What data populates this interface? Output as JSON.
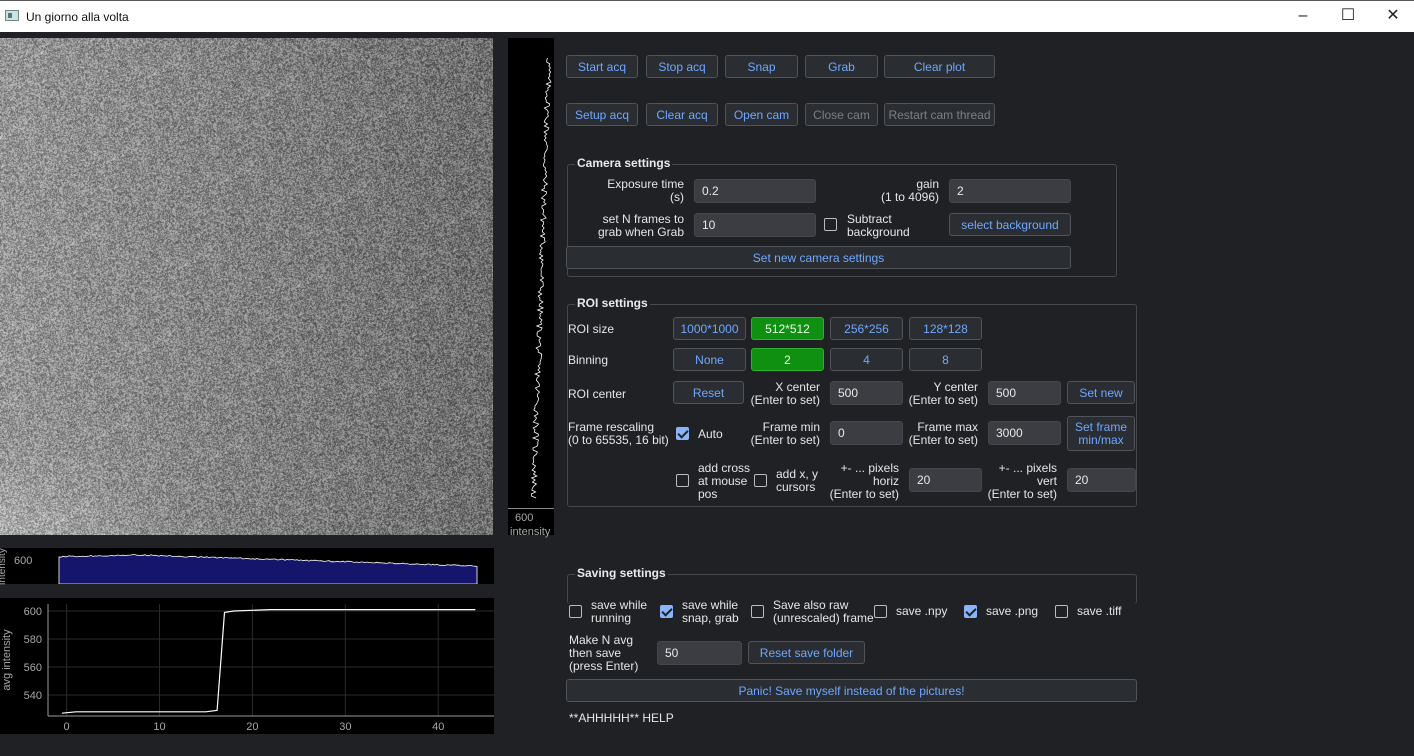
{
  "window": {
    "title": "Un giorno alla volta",
    "minimize_icon": "minimize-icon",
    "maximize_icon": "maximize-icon",
    "close_icon": "close-icon"
  },
  "toolbar": {
    "row1": [
      "Start acq",
      "Stop acq",
      "Snap",
      "Grab",
      "Clear plot"
    ],
    "row2": [
      "Setup acq",
      "Clear acq",
      "Open cam",
      "Close cam",
      "Restart cam thread"
    ]
  },
  "camera": {
    "title": "Camera settings",
    "exposure_label": "Exposure time\n(s)",
    "exposure_value": "0.2",
    "gain_label": "gain\n(1 to 4096)",
    "gain_value": "2",
    "nframes_label": "set N frames to\ngrab when Grab",
    "nframes_value": "10",
    "subtract_label": "Subtract\nbackground",
    "subtract_checked": false,
    "select_bg": "select background",
    "set_new": "Set new camera settings"
  },
  "roi": {
    "title": "ROI settings",
    "size_label": "ROI size",
    "sizes": [
      "1000*1000",
      "512*512",
      "256*256",
      "128*128"
    ],
    "size_active": 1,
    "binning_label": "Binning",
    "binnings": [
      "None",
      "2",
      "4",
      "8"
    ],
    "binning_active": 1,
    "center_label": "ROI center",
    "reset": "Reset",
    "xcenter_label": "X center\n(Enter to set)",
    "xcenter_value": "500",
    "ycenter_label": "Y center\n(Enter to set)",
    "ycenter_value": "500",
    "set_new": "Set new",
    "rescale_label": "Frame rescaling\n(0 to 65535, 16 bit)",
    "auto_label": "Auto",
    "auto_checked": true,
    "fmin_label": "Frame min\n(Enter to set)",
    "fmin_value": "0",
    "fmax_label": "Frame max\n(Enter to set)",
    "fmax_value": "3000",
    "set_frame": "Set frame\nmin/max",
    "cross_label": "add cross\nat mouse\npos",
    "cursors_label": "add x, y\ncursors",
    "horiz_label": "+- ... pixels\nhoriz\n(Enter to set)",
    "horiz_value": "20",
    "vert_label": "+- ... pixels\nvert\n(Enter to set)",
    "vert_value": "20"
  },
  "saving": {
    "title": "Saving settings",
    "options": [
      {
        "label": "save while\nrunning",
        "checked": false
      },
      {
        "label": "save while\nsnap, grab",
        "checked": true
      },
      {
        "label": "Save also raw\n(unrescaled) frame",
        "checked": false
      },
      {
        "label": "save .npy",
        "checked": false
      },
      {
        "label": "save .png",
        "checked": true
      },
      {
        "label": "save .tiff",
        "checked": false
      }
    ],
    "navg_label": "Make N avg\nthen save\n(press Enter)",
    "navg_value": "50",
    "reset_folder": "Reset save folder",
    "panic": "Panic! Save myself instead of the pictures!",
    "help": "**AHHHHH** HELP"
  },
  "side_profile": {
    "tick": "600",
    "axis_label": "intensity"
  },
  "bottom_profile": {
    "tick": "600",
    "axis_label": "intensity"
  },
  "chart_data": {
    "type": "line",
    "ylabel": "avg intensity",
    "xlabel": "",
    "xlim": [
      -2,
      46
    ],
    "ylim": [
      525,
      605
    ],
    "xticks": [
      0,
      10,
      20,
      30,
      40
    ],
    "yticks": [
      540,
      560,
      580,
      600
    ],
    "x": [
      -0.5,
      1,
      5,
      10,
      15,
      16.2,
      17,
      18,
      22,
      25,
      30,
      35,
      40,
      44
    ],
    "y": [
      527,
      528,
      528,
      528,
      528,
      529,
      599,
      600,
      601,
      601,
      601,
      601,
      601,
      601
    ]
  }
}
